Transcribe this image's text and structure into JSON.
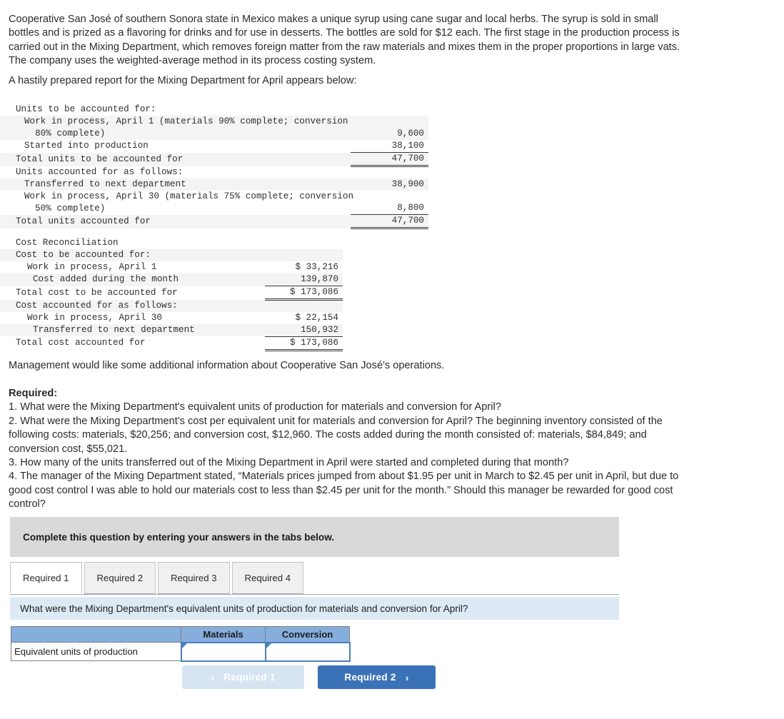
{
  "intro_paragraph": "Cooperative San José of southern Sonora state in Mexico makes a unique syrup using cane sugar and local herbs. The syrup is sold in small bottles and is prized as a flavoring for drinks and for use in desserts. The bottles are sold for $12 each. The first stage in the production process is carried out in the Mixing Department, which removes foreign matter from the raw materials and mixes them in the proper proportions in large vats. The company uses the weighted-average method in its process costing system.",
  "report_intro": "A hastily prepared report for the Mixing Department for April appears below:",
  "management_note": "Management would like some additional information about Cooperative San José's operations.",
  "units_exhibit": {
    "rows": [
      {
        "label": "Units to be accounted for:",
        "label2": "",
        "value": "",
        "indent": 0,
        "shade": false,
        "rule": ""
      },
      {
        "label": "Work in process, April 1 (materials 90% complete; conversion",
        "label2": "80% complete)",
        "value": "9,600",
        "indent": 1,
        "shade": true,
        "rule": ""
      },
      {
        "label": "Started into production",
        "label2": "",
        "value": "38,100",
        "indent": 1,
        "shade": false,
        "rule": "single-bottom"
      },
      {
        "label": "Total units to be accounted for",
        "label2": "",
        "value": "47,700",
        "indent": 0,
        "shade": true,
        "rule": "double-bottom"
      },
      {
        "label": "Units accounted for as follows:",
        "label2": "",
        "value": "",
        "indent": 0,
        "shade": false,
        "rule": ""
      },
      {
        "label": "Transferred to next department",
        "label2": "",
        "value": "38,900",
        "indent": 1,
        "shade": true,
        "rule": ""
      },
      {
        "label": "Work in process, April 30 (materials 75% complete; conversion",
        "label2": "50% complete)",
        "value": "8,800",
        "indent": 1,
        "shade": false,
        "rule": "single-bottom"
      },
      {
        "label": "Total units accounted for",
        "label2": "",
        "value": "47,700",
        "indent": 0,
        "shade": true,
        "rule": "double-bottom"
      }
    ]
  },
  "cost_exhibit": {
    "rows": [
      {
        "label": "Cost Reconciliation",
        "value": "",
        "indent": 0,
        "shade": false,
        "rule": ""
      },
      {
        "label": "Cost to be accounted for:",
        "value": "",
        "indent": 0,
        "shade": true,
        "rule": ""
      },
      {
        "label": "Work in process, April 1",
        "value": "$ 33,216",
        "indent": 1,
        "shade": false,
        "rule": ""
      },
      {
        "label": "Cost added during the month",
        "value": "139,870",
        "indent": 2,
        "shade": true,
        "rule": "single-bottom"
      },
      {
        "label": "Total cost to be accounted for",
        "value": "$ 173,086",
        "indent": 0,
        "shade": false,
        "rule": "double-bottom"
      },
      {
        "label": "Cost accounted for as follows:",
        "value": "",
        "indent": 0,
        "shade": true,
        "rule": ""
      },
      {
        "label": "Work in process, April 30",
        "value": "$ 22,154",
        "indent": 1,
        "shade": false,
        "rule": ""
      },
      {
        "label": "Transferred to next department",
        "value": "150,932",
        "indent": 2,
        "shade": true,
        "rule": "single-bottom"
      },
      {
        "label": "Total cost accounted for",
        "value": "$ 173,086",
        "indent": 0,
        "shade": false,
        "rule": "double-bottom"
      }
    ]
  },
  "required": {
    "heading": "Required:",
    "items": [
      "1. What were the Mixing Department's equivalent units of production for materials and conversion for April?",
      "2. What were the Mixing Department's cost per equivalent unit for materials and conversion for April? The beginning inventory consisted of the following costs: materials, $20,256; and conversion cost, $12,960. The costs added during the month consisted of: materials, $84,849; and conversion cost, $55,021.",
      "3. How many of the units transferred out of the Mixing Department in April were started and completed during that month?",
      "4. The manager of the Mixing Department stated, “Materials prices jumped from about $1.95 per unit in March to $2.45 per unit in April, but due to good cost control I was able to hold our materials cost to less than $2.45 per unit for the month.” Should this manager be rewarded for good cost control?"
    ]
  },
  "instruction_banner": "Complete this question by entering your answers in the tabs below.",
  "tabs": [
    {
      "label": "Required 1",
      "active": true
    },
    {
      "label": "Required 2",
      "active": false
    },
    {
      "label": "Required 3",
      "active": false
    },
    {
      "label": "Required 4",
      "active": false
    }
  ],
  "question_prompt": "What were the Mixing Department's equivalent units of production for materials and conversion for April?",
  "answer_grid": {
    "corner_header": "",
    "column_headers": [
      "Materials",
      "Conversion"
    ],
    "rows": [
      {
        "label": "Equivalent units of production",
        "materials": "",
        "conversion": ""
      }
    ]
  },
  "nav": {
    "prev_label": "Required 1",
    "prev_icon": "chevron-left-icon",
    "prev_glyph": "‹",
    "next_label": "Required 2",
    "next_icon": "chevron-right-icon",
    "next_glyph": "›"
  },
  "colors": {
    "instruction_bg": "#d9d9d9",
    "question_bg": "#ddeaf6",
    "grid_header_bg": "#85aedd",
    "input_border": "#4a7fbd",
    "next_button_bg": "#3a72b8",
    "prev_button_bg": "#d6e4f2",
    "exhibit_shade": "#f4f4f4"
  }
}
